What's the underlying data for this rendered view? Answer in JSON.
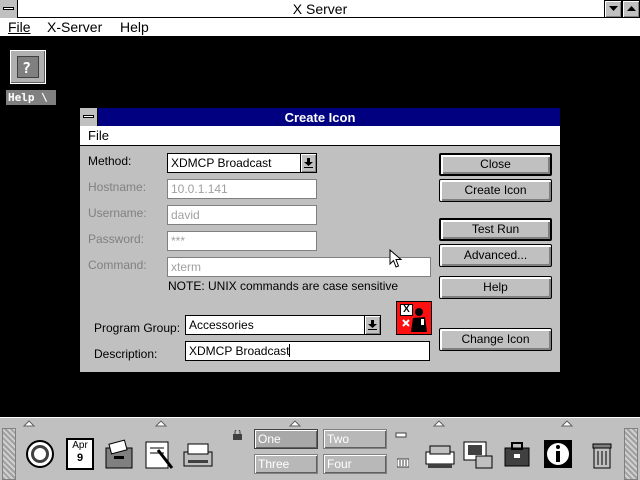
{
  "app": {
    "title": "X Server",
    "menu": [
      "File",
      "X-Server",
      "Help"
    ]
  },
  "desktop_icon": {
    "label": "Help \\"
  },
  "dialog": {
    "title": "Create Icon",
    "menu_file": "File",
    "method": {
      "label": "Method:",
      "value": "XDMCP Broadcast"
    },
    "hostname": {
      "label": "Hostname:",
      "value": "10.0.1.141"
    },
    "username": {
      "label": "Username:",
      "value": "david"
    },
    "password": {
      "label": "Password:",
      "value": "***"
    },
    "command": {
      "label": "Command:",
      "value": "xterm"
    },
    "note": "NOTE: UNIX commands are case sensitive",
    "program_group": {
      "label": "Program Group:",
      "value": "Accessories"
    },
    "description": {
      "label": "Description:",
      "value": "XDMCP Broadcast"
    },
    "buttons": {
      "close": "Close",
      "create_icon": "Create Icon",
      "test_run": "Test Run",
      "advanced": "Advanced...",
      "help": "Help",
      "change_icon": "Change Icon"
    }
  },
  "dock": {
    "calendar": {
      "month": "Apr",
      "day": "9"
    },
    "desktops": [
      "One",
      "Two",
      "Three",
      "Four"
    ]
  }
}
